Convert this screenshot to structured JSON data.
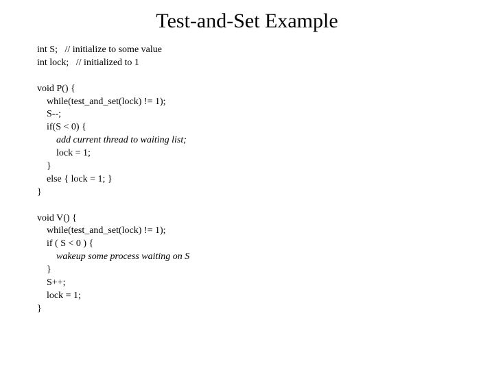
{
  "title": "Test-and-Set Example",
  "code": {
    "l01": "int S;   // initialize to some value",
    "l02": "int lock;   // initialized to 1",
    "l03": "",
    "l04": "void P() {",
    "l05": "    while(test_and_set(lock) != 1);",
    "l06": "    S--;",
    "l07": "    if(S < 0) {",
    "l08a": "        ",
    "l08b": "add current thread to waiting list;",
    "l09": "        lock = 1;",
    "l10": "    }",
    "l11": "    else { lock = 1; }",
    "l12": "}",
    "l13": "",
    "l14": "void V() {",
    "l15": "    while(test_and_set(lock) != 1);",
    "l16": "    if ( S < 0 ) {",
    "l17a": "        ",
    "l17b": "wakeup some process waiting on S",
    "l18": "    }",
    "l19": "    S++;",
    "l20": "    lock = 1;",
    "l21": "}"
  }
}
